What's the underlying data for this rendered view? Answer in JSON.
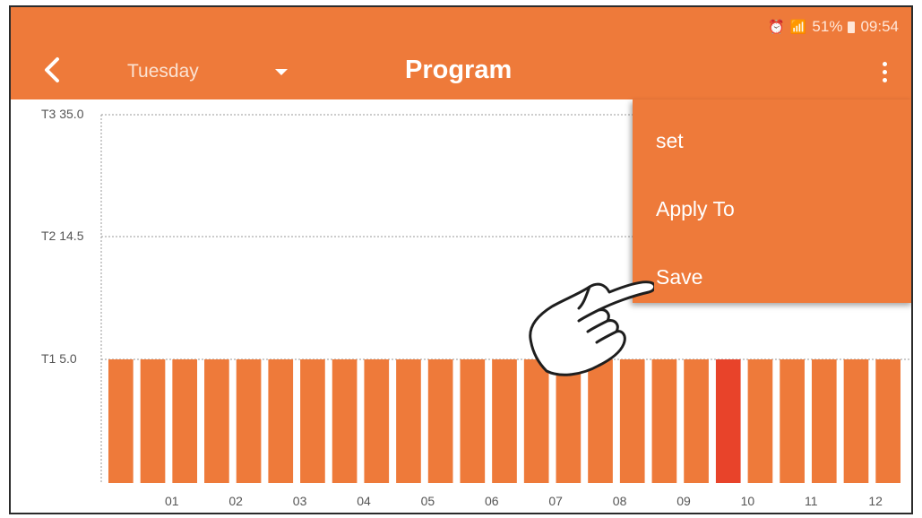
{
  "status": {
    "battery": "51%",
    "time": "09:54"
  },
  "header": {
    "day": "Tuesday",
    "title": "Program"
  },
  "menu": {
    "items": [
      "set",
      "Apply To",
      "Save"
    ]
  },
  "schedule": {
    "y_levels": [
      {
        "label": "T3 35.0",
        "value": 35.0
      },
      {
        "label": "T2 14.5",
        "value": 14.5
      },
      {
        "label": "T1 5.0",
        "value": 5.0
      }
    ],
    "x_labels": [
      "01",
      "02",
      "03",
      "04",
      "05",
      "06",
      "07",
      "08",
      "09",
      "10",
      "11",
      "12"
    ],
    "slots": [
      5,
      5,
      5,
      5,
      5,
      5,
      5,
      5,
      5,
      5,
      5,
      5,
      5,
      5,
      5,
      5,
      5,
      5,
      5,
      5,
      5,
      5,
      5,
      5,
      5
    ],
    "selected_slot": 19
  },
  "colors": {
    "bar": "#ee7a3a",
    "bar_selected": "#e8432a",
    "appbar": "#ee7a3a"
  }
}
